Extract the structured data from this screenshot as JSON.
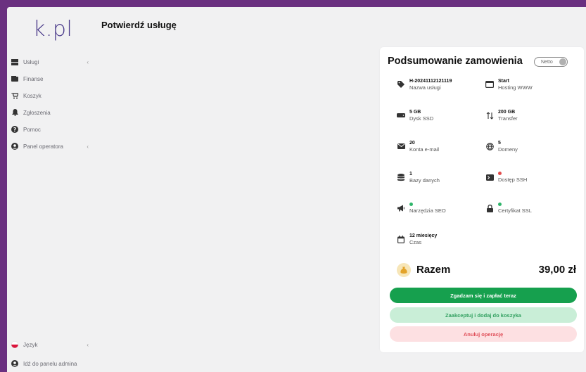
{
  "brand": {
    "logo_text": "k.pl",
    "accent": "#4a3a8a"
  },
  "sidebar": {
    "items": [
      {
        "label": "Usługi",
        "icon": "server-icon",
        "has_chevron": true
      },
      {
        "label": "Finanse",
        "icon": "wallet-icon",
        "has_chevron": false
      },
      {
        "label": "Koszyk",
        "icon": "cart-icon",
        "has_chevron": false
      },
      {
        "label": "Zgłoszenia",
        "icon": "bell-icon",
        "has_chevron": false
      },
      {
        "label": "Pomoc",
        "icon": "help-icon",
        "has_chevron": false
      },
      {
        "label": "Panel operatora",
        "icon": "user-icon",
        "has_chevron": true
      }
    ],
    "language": {
      "label": "Język",
      "icon": "poland-flag-icon"
    },
    "admin_link": {
      "label": "Idź do panelu admina",
      "icon": "user-icon"
    },
    "chevron": "‹"
  },
  "page": {
    "title": "Potwierdź usługę"
  },
  "summary": {
    "title": "Podsumowanie zamowienia",
    "toggle_label": "Netto",
    "features": [
      {
        "value": "H-20241112121119",
        "label": "Nazwa usługi",
        "icon": "tag-icon"
      },
      {
        "value": "Start",
        "label": "Hosting WWW",
        "icon": "window-icon"
      },
      {
        "value": "5 GB",
        "label": "Dysk SSD",
        "icon": "drive-icon"
      },
      {
        "value": "200 GB",
        "label": "Transfer",
        "icon": "transfer-icon"
      },
      {
        "value": "20",
        "label": "Konta e-mail",
        "icon": "mail-icon"
      },
      {
        "value": "5",
        "label": "Domeny",
        "icon": "globe-icon"
      },
      {
        "value": "1",
        "label": "Bazy danych",
        "icon": "database-icon"
      },
      {
        "value": "",
        "label": "Dostęp SSH",
        "icon": "terminal-icon",
        "status": "off"
      },
      {
        "value": "",
        "label": "Narzędzia SEO",
        "icon": "megaphone-icon",
        "status": "on"
      },
      {
        "value": "",
        "label": "Certyfikat SSL",
        "icon": "lock-icon",
        "status": "on"
      },
      {
        "value": "12 miesięcy",
        "label": "Czas",
        "icon": "calendar-icon"
      }
    ],
    "total_label": "Razem",
    "total_value": "39,00 zł",
    "buttons": {
      "pay": "Zgadzam się i zapłać teraz",
      "cart": "Zaakceptuj i dodaj do koszyka",
      "cancel": "Anuluj operację"
    }
  }
}
